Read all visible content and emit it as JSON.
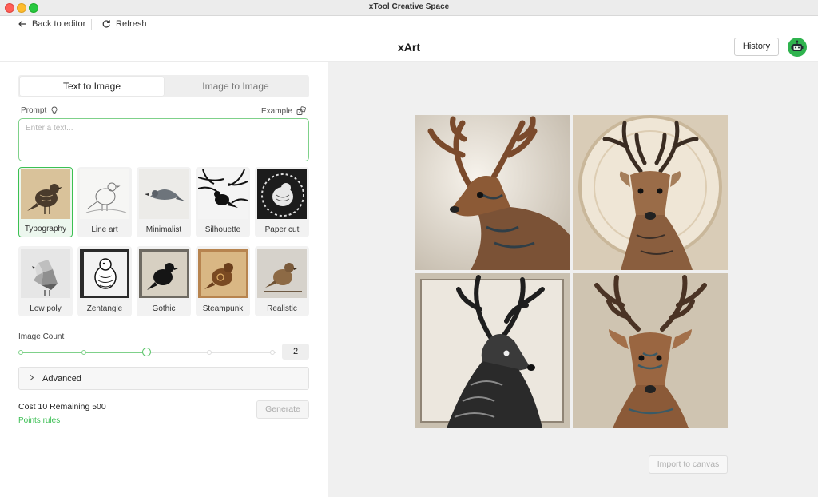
{
  "window": {
    "title": "xTool Creative Space"
  },
  "topbar": {
    "back_label": "Back to editor",
    "refresh_label": "Refresh"
  },
  "header": {
    "title": "xArt",
    "history_label": "History"
  },
  "tabs": [
    {
      "label": "Text to Image",
      "active": true
    },
    {
      "label": "Image to Image",
      "active": false
    }
  ],
  "prompt": {
    "label": "Prompt",
    "example_label": "Example",
    "placeholder": "Enter a text...",
    "value": ""
  },
  "styles": [
    {
      "name": "Typography",
      "selected": true
    },
    {
      "name": "Line art",
      "selected": false
    },
    {
      "name": "Minimalist",
      "selected": false
    },
    {
      "name": "Silhouette",
      "selected": false
    },
    {
      "name": "Paper cut",
      "selected": false
    },
    {
      "name": "Low poly",
      "selected": false
    },
    {
      "name": "Zentangle",
      "selected": false
    },
    {
      "name": "Gothic",
      "selected": false
    },
    {
      "name": "Steampunk",
      "selected": false
    },
    {
      "name": "Realistic",
      "selected": false
    }
  ],
  "image_count": {
    "label": "Image Count",
    "value": "2",
    "min": 1,
    "max": 5,
    "current": 3
  },
  "advanced": {
    "label": "Advanced"
  },
  "footer": {
    "cost_text": "Cost 10 Remaining 500",
    "points_rules": "Points rules",
    "generate_label": "Generate"
  },
  "preview": {
    "import_label": "Import to canvas",
    "image_count": 4
  },
  "colors": {
    "accent": "#3cbf54",
    "accent_light": "#7fd18a",
    "panel_bg": "#f0f0f0"
  }
}
